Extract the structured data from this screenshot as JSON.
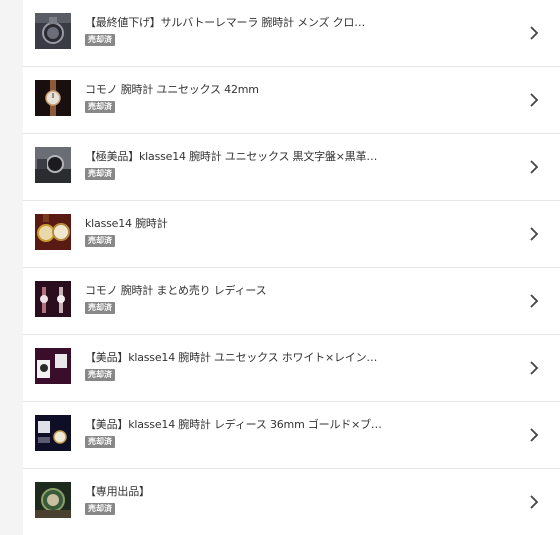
{
  "colors": {
    "background": "#f4f4f4",
    "card": "#ffffff",
    "divider": "#e7e7e7",
    "title_text": "#333333",
    "badge_bg": "#888888",
    "badge_text": "#ffffff",
    "chevron": "#444444"
  },
  "items": [
    {
      "title": "【最終値下げ】サルバトーレマーラ 腕時計 メンズ クロ…",
      "status": "売却済",
      "thumb_icon": "watch-photo-icon"
    },
    {
      "title": "コモノ 腕時計 ユニセックス 42mm",
      "status": "売却済",
      "thumb_icon": "watch-photo-icon"
    },
    {
      "title": "【極美品】klasse14 腕時計 ユニセックス 黒文字盤×黒革…",
      "status": "売却済",
      "thumb_icon": "watch-photo-icon"
    },
    {
      "title": "klasse14 腕時計",
      "status": "売却済",
      "thumb_icon": "watch-photo-icon"
    },
    {
      "title": "コモノ 腕時計 まとめ売り レディース",
      "status": "売却済",
      "thumb_icon": "watch-photo-icon"
    },
    {
      "title": "【美品】klasse14 腕時計 ユニセックス ホワイト×レイン…",
      "status": "売却済",
      "thumb_icon": "watch-photo-icon"
    },
    {
      "title": "【美品】klasse14 腕時計 レディース 36mm ゴールド×ブ…",
      "status": "売却済",
      "thumb_icon": "watch-photo-icon"
    },
    {
      "title": "【専用出品】",
      "status": "売却済",
      "thumb_icon": "watch-photo-icon"
    }
  ]
}
